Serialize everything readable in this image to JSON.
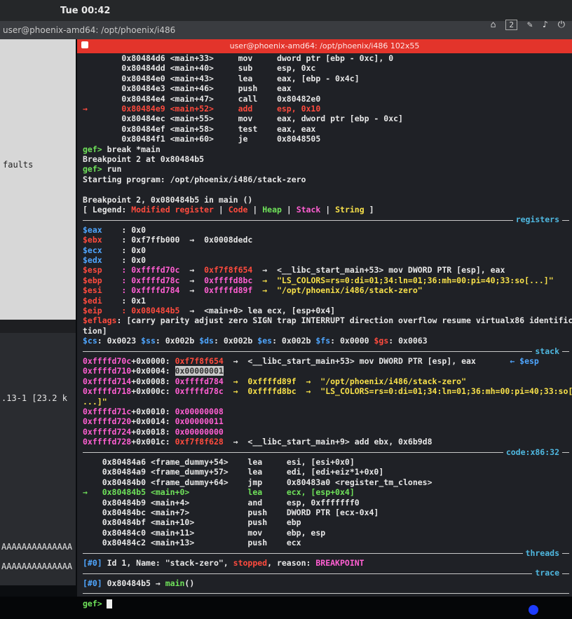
{
  "system": {
    "clock": "Tue 00:42",
    "window_title": "user@phoenix-amd64: /opt/phoenix/i486",
    "tray_badge": "2"
  },
  "left_terminal": {
    "text1": "faults",
    "text2": ".13-1 [23.2 k",
    "text3": "AAAAAAAAAAAAAA",
    "text4": "AAAAAAAAAAAAAA"
  },
  "terminal": {
    "title": "user@phoenix-amd64: /opt/phoenix/i486 102x55",
    "disasm_top": [
      {
        "arrow": "",
        "addr": "0x80484d6 <main+33>",
        "op": "mov",
        "args": "dword ptr [ebp - 0xc], 0",
        "hl": false
      },
      {
        "arrow": "",
        "addr": "0x80484dd <main+40>",
        "op": "sub",
        "args": "esp, 0xc",
        "hl": false
      },
      {
        "arrow": "",
        "addr": "0x80484e0 <main+43>",
        "op": "lea",
        "args": "eax, [ebp - 0x4c]",
        "hl": false
      },
      {
        "arrow": "",
        "addr": "0x80484e3 <main+46>",
        "op": "push",
        "args": "eax",
        "hl": false
      },
      {
        "arrow": "",
        "addr": "0x80484e4 <main+47>",
        "op": "call",
        "args": "0x80482e0",
        "hl": false
      },
      {
        "arrow": "→",
        "addr": "0x80484e9 <main+52>",
        "op": "add",
        "args": "esp, 0x10",
        "hl": true
      },
      {
        "arrow": "",
        "addr": "0x80484ec <main+55>",
        "op": "mov",
        "args": "eax, dword ptr [ebp - 0xc]",
        "hl": false
      },
      {
        "arrow": "",
        "addr": "0x80484ef <main+58>",
        "op": "test",
        "args": "eax, eax",
        "hl": false
      },
      {
        "arrow": "",
        "addr": "0x80484f1 <main+60>",
        "op": "je",
        "args": "0x8048505",
        "hl": false
      }
    ],
    "prompt": "gef>",
    "cmd1": " break *main",
    "out1": "Breakpoint 2 at 0x80484b5",
    "cmd2": " run",
    "out2": "Starting program: /opt/phoenix/i486/stack-zero",
    "out3": "Breakpoint 2, 0x080484b5 in main ()",
    "legend": {
      "open": "[ Legend: ",
      "modified": "Modified register",
      "code": "Code",
      "heap": "Heap",
      "stack": "Stack",
      "string": "String",
      "close": " ]",
      "pipe": " | "
    },
    "sections": {
      "registers": "registers",
      "stack": "stack",
      "code": "code:x86:32",
      "threads": "threads",
      "trace": "trace"
    },
    "registers": [
      {
        "name": "$eax",
        "val": ": 0x0",
        "rest": ""
      },
      {
        "name": "$ebx",
        "val": ": 0xf7ffb000",
        "rest": "  →  0x0008dedc"
      },
      {
        "name": "$ecx",
        "val": ": 0x0",
        "rest": ""
      },
      {
        "name": "$edx",
        "val": ": 0x0",
        "rest": ""
      },
      {
        "name": "$esp",
        "val": ": 0xffffd70c",
        "ptr": "0xf7f8f654",
        "rest": "  →  <__libc_start_main+53> mov DWORD PTR [esp], eax"
      },
      {
        "name": "$ebp",
        "val": ": 0xffffd78c",
        "ptr": "0xffffd8bc",
        "rest": "  →  \"LS_COLORS=rs=0:di=01;34:ln=01;36:mh=00:pi=40;33:so[...]\""
      },
      {
        "name": "$esi",
        "val": ": 0xffffd784",
        "ptr": "0xffffd89f",
        "rest": "  →  \"/opt/phoenix/i486/stack-zero\""
      },
      {
        "name": "$edi",
        "val": ": 0x1",
        "rest": ""
      },
      {
        "name": "$eip",
        "val": ": 0x080484b5",
        "rest": "  →  <main+0> lea ecx, [esp+0x4]"
      }
    ],
    "eflags_name": "$eflags",
    "eflags_val": ": [carry parity adjust zero SIGN trap INTERRUPT direction overflow resume virtualx86 identifica",
    "eflags_wrap": "tion]",
    "segments": {
      "cs": "$cs",
      "cs_v": ": 0x0023 ",
      "ss": "$ss",
      "ss_v": ": 0x002b ",
      "ds": "$ds",
      "ds_v": ": 0x002b ",
      "es": "$es",
      "es_v": ": 0x002b ",
      "fs": "$fs",
      "fs_v": ": 0x0000 ",
      "gs": "$gs",
      "gs_v": ": 0x0063"
    },
    "stack": [
      {
        "addr": "0xffffd70c",
        "off": "+0x0000: ",
        "val": "0xf7f8f654",
        "rest": "  →  <__libc_start_main+53> mov DWORD PTR [esp], eax",
        "tag": "← $esp",
        "sel": false
      },
      {
        "addr": "0xffffd710",
        "off": "+0x0004: ",
        "val": "0x00000001",
        "rest": "",
        "tag": "",
        "sel": true
      },
      {
        "addr": "0xffffd714",
        "off": "+0x0008: ",
        "val": "0xffffd784",
        "rest": "  →  0xffffd89f  →  \"/opt/phoenix/i486/stack-zero\"",
        "tag": "",
        "sel": false
      },
      {
        "addr": "0xffffd718",
        "off": "+0x000c: ",
        "val": "0xffffd78c",
        "rest": "  →  0xffffd8bc  →  \"LS_COLORS=rs=0:di=01;34:ln=01;36:mh=00:pi=40;33:so[",
        "tag": "",
        "sel": false
      },
      {
        "addr": "0xffffd71c",
        "off": "+0x0010: ",
        "val": "0x00000008",
        "rest": "",
        "tag": "",
        "sel": false
      },
      {
        "addr": "0xffffd720",
        "off": "+0x0014: ",
        "val": "0x00000011",
        "rest": "",
        "tag": "",
        "sel": false
      },
      {
        "addr": "0xffffd724",
        "off": "+0x0018: ",
        "val": "0x00000000",
        "rest": "",
        "tag": "",
        "sel": false
      },
      {
        "addr": "0xffffd728",
        "off": "+0x001c: ",
        "val": "0xf7f8f628",
        "rest": "  →  <__libc_start_main+9> add ebx, 0x6b9d8",
        "tag": "",
        "sel": false
      }
    ],
    "stack_wrap": "...]\"",
    "code": [
      {
        "arrow": "",
        "addr": "0x80484a6 <frame_dummy+54>",
        "op": "lea",
        "args": "esi, [esi+0x0]",
        "cur": false
      },
      {
        "arrow": "",
        "addr": "0x80484a9 <frame_dummy+57>",
        "op": "lea",
        "args": "edi, [edi+eiz*1+0x0]",
        "cur": false
      },
      {
        "arrow": "",
        "addr": "0x80484b0 <frame_dummy+64>",
        "op": "jmp",
        "args": "0x80483a0 <register_tm_clones>",
        "cur": false
      },
      {
        "arrow": "→",
        "addr": "0x80484b5 <main+0>",
        "op": "lea",
        "args": "ecx, [esp+0x4]",
        "cur": true
      },
      {
        "arrow": "",
        "addr": "0x80484b9 <main+4>",
        "op": "and",
        "args": "esp, 0xfffffff0",
        "cur": false
      },
      {
        "arrow": "",
        "addr": "0x80484bc <main+7>",
        "op": "push",
        "args": "DWORD PTR [ecx-0x4]",
        "cur": false
      },
      {
        "arrow": "",
        "addr": "0x80484bf <main+10>",
        "op": "push",
        "args": "ebp",
        "cur": false
      },
      {
        "arrow": "",
        "addr": "0x80484c0 <main+11>",
        "op": "mov",
        "args": "ebp, esp",
        "cur": false
      },
      {
        "arrow": "",
        "addr": "0x80484c2 <main+13>",
        "op": "push",
        "args": "ecx",
        "cur": false
      }
    ],
    "thread": {
      "id": "[#0]",
      "text": " Id 1, Name: \"stack-zero\", ",
      "stopped": "stopped",
      "reason": ", reason: ",
      "bp": "BREAKPOINT"
    },
    "trace": {
      "id": "[#0]",
      "addr": " 0x80484b5 → ",
      "fn": "main",
      "paren": "()"
    }
  }
}
